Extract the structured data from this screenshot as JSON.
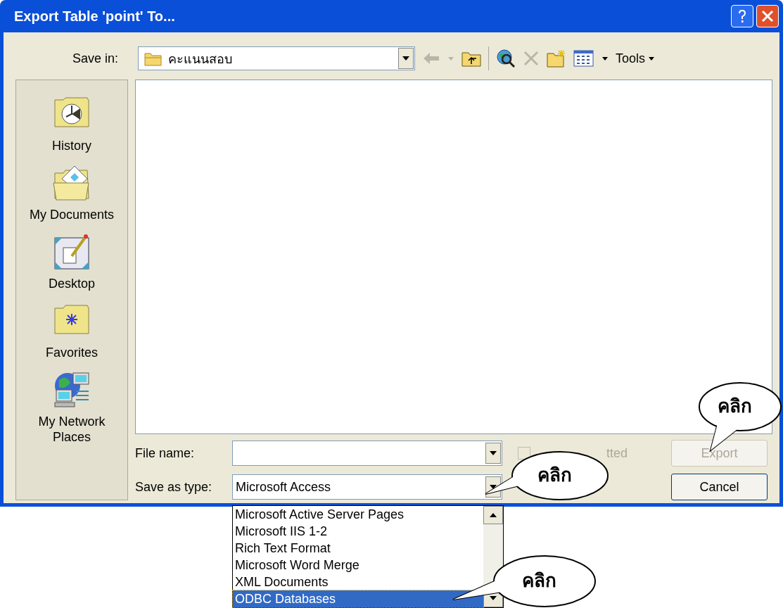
{
  "window": {
    "title": "Export Table 'point' To..."
  },
  "toolbar": {
    "save_in_label": "Save in:",
    "location": "คะแนนสอบ",
    "tools_label": "Tools"
  },
  "places": [
    {
      "label": "History",
      "kind": "history"
    },
    {
      "label": "My Documents",
      "kind": "documents"
    },
    {
      "label": "Desktop",
      "kind": "desktop"
    },
    {
      "label": "Favorites",
      "kind": "favorites"
    },
    {
      "label": "My Network Places",
      "kind": "network"
    }
  ],
  "file_name": {
    "label": "File name:"
  },
  "save_as_type": {
    "label": "Save as type:",
    "value": "Microsoft Access"
  },
  "formatted_checkbox": {
    "label": "tted",
    "disabled": true
  },
  "buttons": [
    {
      "label": "Export",
      "disabled": true
    },
    {
      "label": "Cancel",
      "disabled": false
    }
  ],
  "type_list": [
    {
      "label": "Microsoft Active Server Pages",
      "selected": false
    },
    {
      "label": "Microsoft IIS 1-2",
      "selected": false
    },
    {
      "label": "Rich Text Format",
      "selected": false
    },
    {
      "label": "Microsoft Word Merge",
      "selected": false
    },
    {
      "label": "XML Documents",
      "selected": false
    },
    {
      "label": "ODBC Databases",
      "selected": true
    }
  ],
  "callouts": [
    {
      "text": "คลิก",
      "kind": "right"
    },
    {
      "text": "คลิก",
      "kind": "left"
    },
    {
      "text": "คลิก",
      "kind": "lower"
    }
  ]
}
